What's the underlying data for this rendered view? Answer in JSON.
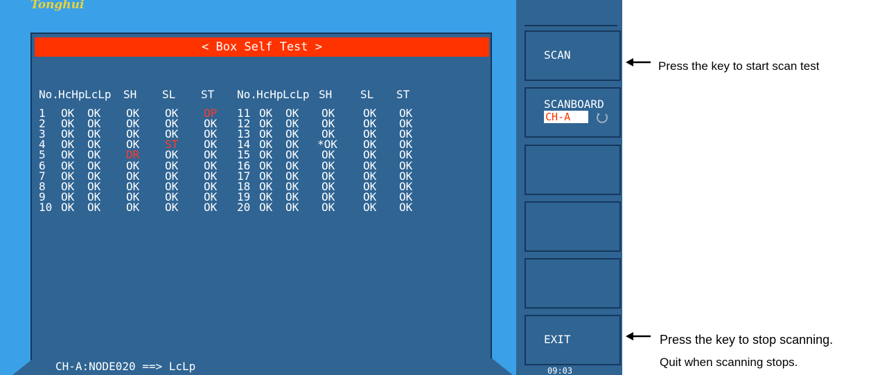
{
  "brand": {
    "logo_text": "Tonghui"
  },
  "screen": {
    "title": "< Box Self Test >",
    "status_line": "CH-A:NODE020 ==> LcLp",
    "time": "09:03"
  },
  "table": {
    "headers_left": [
      "No.",
      "HcHp",
      "LcLp",
      "SH",
      "SL",
      "ST"
    ],
    "headers_right": [
      "No.",
      "HcHp",
      "LcLp",
      "SH",
      "SL",
      "ST"
    ],
    "rows_left": [
      [
        "1",
        "OK",
        "OK",
        "OK",
        "OK",
        "OP"
      ],
      [
        "2",
        "OK",
        "OK",
        "OK",
        "OK",
        "OK"
      ],
      [
        "3",
        "OK",
        "OK",
        "OK",
        "OK",
        "OK"
      ],
      [
        "4",
        "OK",
        "OK",
        "OK",
        "ST",
        "OK"
      ],
      [
        "5",
        "OK",
        "OK",
        "DR",
        "OK",
        "OK"
      ],
      [
        "6",
        "OK",
        "OK",
        "OK",
        "OK",
        "OK"
      ],
      [
        "7",
        "OK",
        "OK",
        "OK",
        "OK",
        "OK"
      ],
      [
        "8",
        "OK",
        "OK",
        "OK",
        "OK",
        "OK"
      ],
      [
        "9",
        "OK",
        "OK",
        "OK",
        "OK",
        "OK"
      ],
      [
        "10",
        "OK",
        "OK",
        "OK",
        "OK",
        "OK"
      ]
    ],
    "rows_right": [
      [
        "11",
        "OK",
        "OK",
        "OK",
        "OK",
        "OK"
      ],
      [
        "12",
        "OK",
        "OK",
        "OK",
        "OK",
        "OK"
      ],
      [
        "13",
        "OK",
        "OK",
        "OK",
        "OK",
        "OK"
      ],
      [
        "14",
        "OK",
        "OK",
        "*OK",
        "OK",
        "OK"
      ],
      [
        "15",
        "OK",
        "OK",
        "OK",
        "OK",
        "OK"
      ],
      [
        "16",
        "OK",
        "OK",
        "OK",
        "OK",
        "OK"
      ],
      [
        "17",
        "OK",
        "OK",
        "OK",
        "OK",
        "OK"
      ],
      [
        "18",
        "OK",
        "OK",
        "OK",
        "OK",
        "OK"
      ],
      [
        "19",
        "OK",
        "OK",
        "OK",
        "OK",
        "OK"
      ],
      [
        "20",
        "OK",
        "OK",
        "OK",
        "OK",
        "OK"
      ]
    ],
    "fault_color": "#ff3b2b",
    "ok_color": "#ffffff"
  },
  "softkeys": {
    "scan_label": "SCAN",
    "scanboard_label": "SCANBOARD",
    "scanboard_value": "CH-A",
    "exit_label": "EXIT"
  },
  "annotations": {
    "scan_note": "Press the key to start scan test",
    "exit_note_1": "Press the key to stop scanning.",
    "exit_note_2": "Quit when scanning stops."
  },
  "colors": {
    "screen_bg": "#3aa0e8",
    "panel_bg": "#2f6493",
    "title_bar": "#ff3300",
    "logo": "#e8d23c"
  }
}
